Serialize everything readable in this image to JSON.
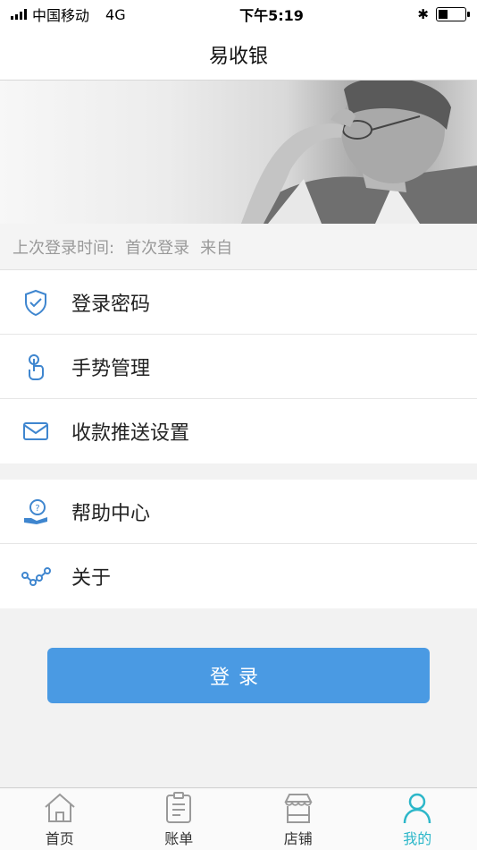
{
  "status_bar": {
    "carrier": "中国移动",
    "network": "4G",
    "time": "下午5:19"
  },
  "nav": {
    "title": "易收银"
  },
  "last_login": {
    "label": "上次登录时间:",
    "value": "首次登录",
    "from_label": "来自"
  },
  "menu_group_1": [
    {
      "label": "登录密码",
      "icon": "shield-icon"
    },
    {
      "label": "手势管理",
      "icon": "finger-touch-icon"
    },
    {
      "label": "收款推送设置",
      "icon": "envelope-icon"
    }
  ],
  "menu_group_2": [
    {
      "label": "帮助中心",
      "icon": "help-hand-icon"
    },
    {
      "label": "关于",
      "icon": "about-nodes-icon"
    }
  ],
  "login_button": {
    "label": "登录"
  },
  "tabs": [
    {
      "label": "首页",
      "icon": "home-icon"
    },
    {
      "label": "账单",
      "icon": "bill-icon"
    },
    {
      "label": "店铺",
      "icon": "shop-icon"
    },
    {
      "label": "我的",
      "icon": "user-icon",
      "active": true
    }
  ],
  "colors": {
    "accent": "#4a9ae3",
    "tab_active": "#2db7c9",
    "icon_blue": "#3f86cf"
  }
}
